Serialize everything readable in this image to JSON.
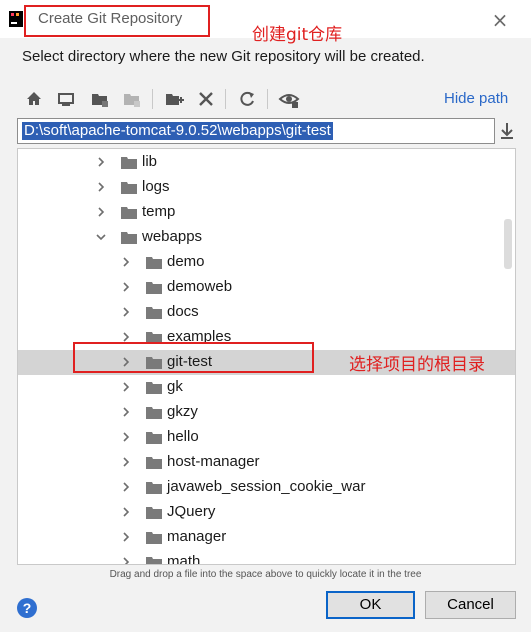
{
  "window": {
    "title": "Create Git Repository",
    "close_glyph": "×",
    "app_icon": "intellij-icon"
  },
  "annotations": {
    "title_note": "创建git仓库",
    "selection_note": "选择项目的根目录"
  },
  "description": "Select directory where the new Git repository will be created.",
  "toolbar": {
    "icons": [
      "home-icon",
      "desktop-icon",
      "project-folder-icon",
      "module-folder-icon",
      "new-folder-icon",
      "delete-icon",
      "refresh-icon",
      "show-hidden-icon"
    ],
    "hide_path_label": "Hide path"
  },
  "path": {
    "value": "D:\\soft\\apache-tomcat-9.0.52\\webapps\\git-test"
  },
  "tree": {
    "rows": [
      {
        "label": "lib",
        "level": 1,
        "expanded": false
      },
      {
        "label": "logs",
        "level": 1,
        "expanded": false
      },
      {
        "label": "temp",
        "level": 1,
        "expanded": false
      },
      {
        "label": "webapps",
        "level": 1,
        "expanded": true
      },
      {
        "label": "demo",
        "level": 2,
        "expanded": false
      },
      {
        "label": "demoweb",
        "level": 2,
        "expanded": false
      },
      {
        "label": "docs",
        "level": 2,
        "expanded": false
      },
      {
        "label": "examples",
        "level": 2,
        "expanded": false
      },
      {
        "label": "git-test",
        "level": 2,
        "expanded": false,
        "selected": true
      },
      {
        "label": "gk",
        "level": 2,
        "expanded": false
      },
      {
        "label": "gkzy",
        "level": 2,
        "expanded": false
      },
      {
        "label": "hello",
        "level": 2,
        "expanded": false
      },
      {
        "label": "host-manager",
        "level": 2,
        "expanded": false
      },
      {
        "label": "javaweb_session_cookie_war",
        "level": 2,
        "expanded": false
      },
      {
        "label": "JQuery",
        "level": 2,
        "expanded": false
      },
      {
        "label": "manager",
        "level": 2,
        "expanded": false
      },
      {
        "label": "math",
        "level": 2,
        "expanded": false
      }
    ]
  },
  "footer": {
    "hint": "Drag and drop a file into the space above to quickly locate it in the tree",
    "help_glyph": "?",
    "ok_label": "OK",
    "cancel_label": "Cancel"
  },
  "colors": {
    "accent": "#2a68c8",
    "annotation": "#e02020",
    "selection": "#d4d4d4",
    "path_highlight": "#2e5fb4"
  }
}
